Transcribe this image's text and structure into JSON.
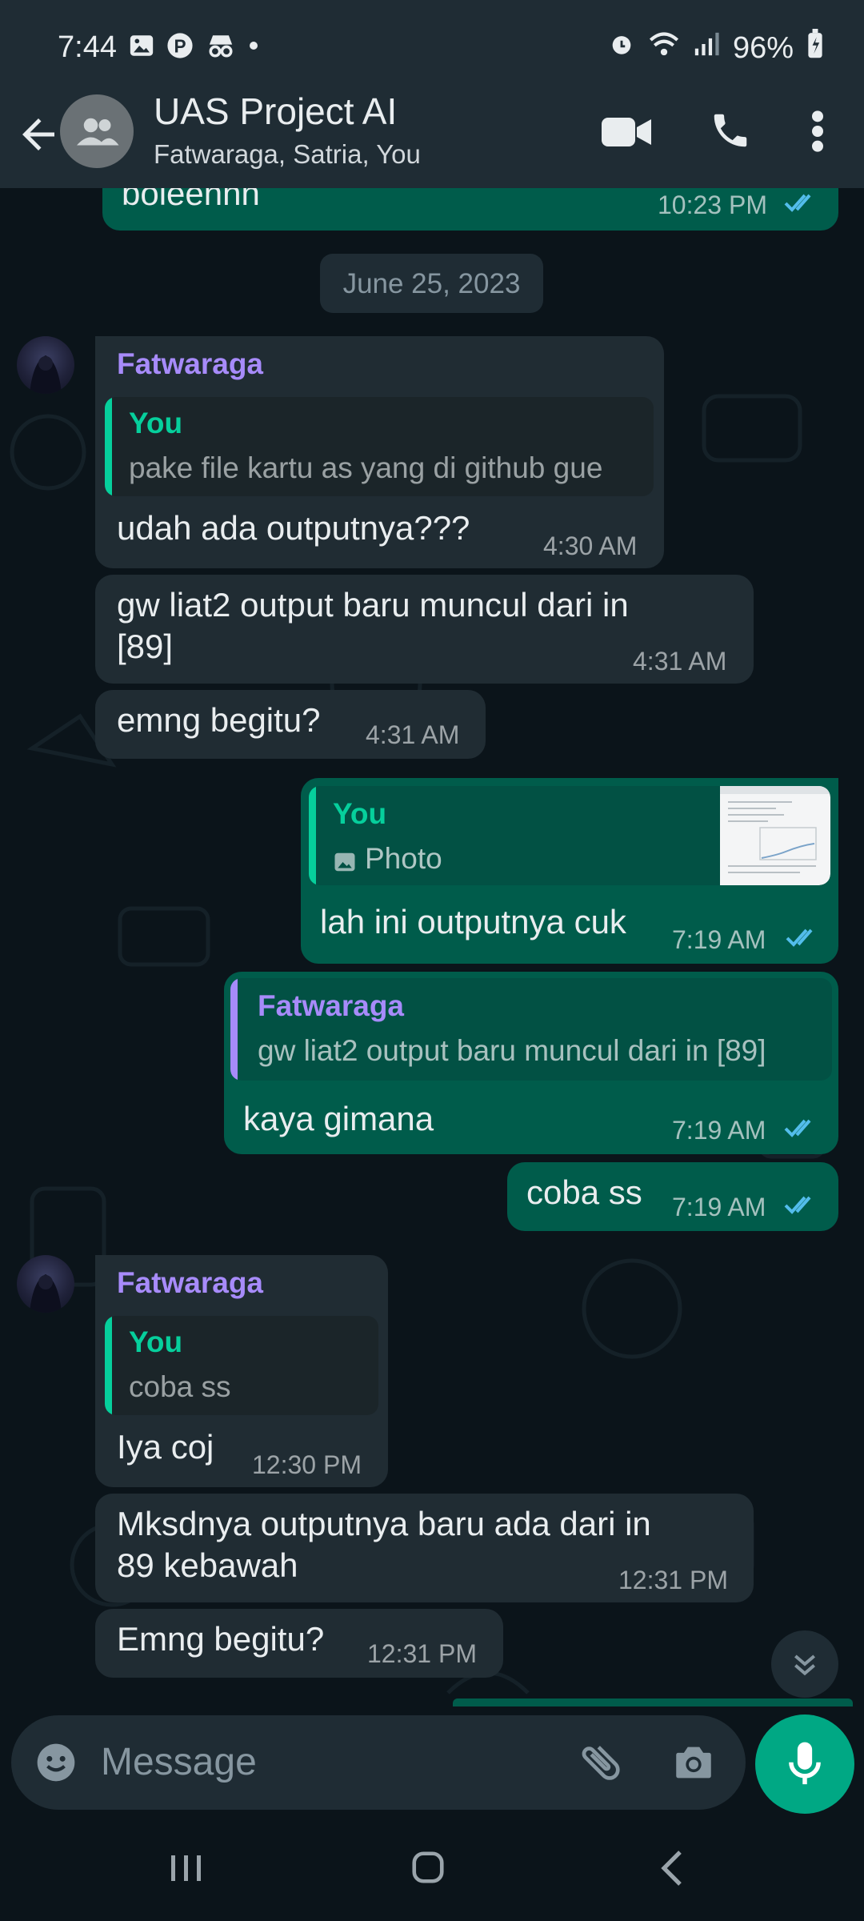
{
  "status_bar": {
    "time": "7:44",
    "battery": "96%"
  },
  "header": {
    "title": "UAS Project AI",
    "subtitle": "Fatwaraga, Satria, You"
  },
  "date_chip": "June 25, 2023",
  "messages": {
    "m0": {
      "text": "boleennn",
      "time": "10:23 PM"
    },
    "m1": {
      "sender": "Fatwaraga",
      "quote_sender": "You",
      "quote_text": "pake file kartu as yang di github gue",
      "text": "udah ada outputnya???",
      "time": "4:30 AM"
    },
    "m2": {
      "line1": "gw liat2 output baru muncul dari in",
      "line2": "[89]",
      "time": "4:31 AM"
    },
    "m3": {
      "text": "emng begitu?",
      "time": "4:31 AM"
    },
    "m4": {
      "quote_sender": "You",
      "quote_text": "Photo",
      "text": "lah ini outputnya cuk",
      "time": "7:19 AM"
    },
    "m5": {
      "quote_sender": "Fatwaraga",
      "quote_text": "gw liat2 output baru muncul dari in [89]",
      "text": "kaya gimana",
      "time": "7:19 AM"
    },
    "m6": {
      "text": "coba ss",
      "time": "7:19 AM"
    },
    "m7": {
      "sender": "Fatwaraga",
      "quote_sender": "You",
      "quote_text": "coba ss",
      "text": "Iya coj",
      "time": "12:30 PM"
    },
    "m8": {
      "line1": "Mksdnya outputnya baru ada dari in",
      "line2": "89 kebawah",
      "time": "12:31 PM"
    },
    "m9": {
      "text": "Emng begitu?",
      "time": "12:31 PM"
    }
  },
  "composer": {
    "placeholder": "Message"
  },
  "colors": {
    "outgoing": "#005c4b",
    "incoming": "#202c33",
    "accent": "#00a884",
    "sender_name": "#a78bfa",
    "read_tick": "#53bdeb"
  },
  "icons": [
    "back-arrow-icon",
    "group-icon",
    "video-call-icon",
    "phone-icon",
    "more-icon",
    "emoji-icon",
    "attach-icon",
    "camera-icon",
    "mic-icon",
    "scroll-down-icon",
    "recents-icon",
    "home-icon",
    "nav-back-icon"
  ]
}
